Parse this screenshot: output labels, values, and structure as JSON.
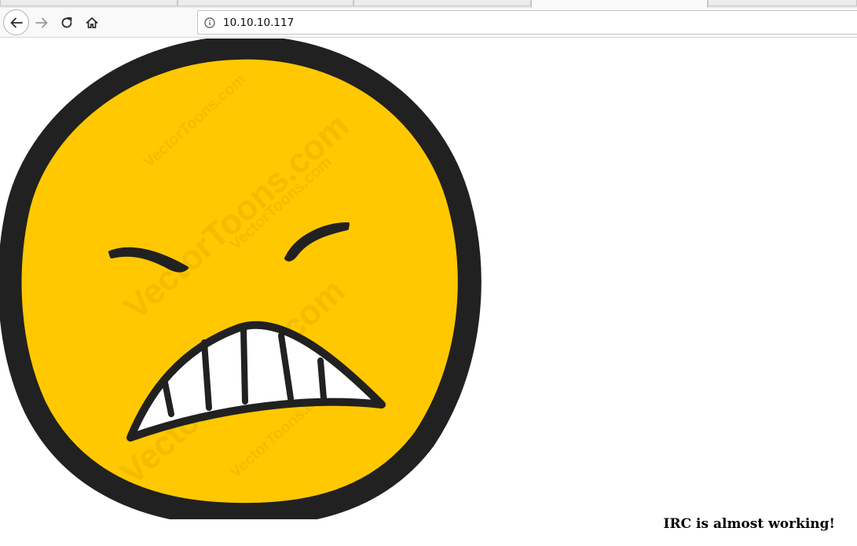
{
  "browser": {
    "url": "10.10.10.117",
    "icons": {
      "back": "arrow-left-icon",
      "forward": "arrow-right-icon",
      "reload": "reload-icon",
      "home": "home-icon",
      "site_info": "info-icon"
    }
  },
  "page": {
    "image": {
      "subject": "angry-smiley-face",
      "watermark": "VectorToons.com",
      "colors": {
        "face": "#ffc800",
        "outline": "#212121",
        "teeth": "#ffffff"
      }
    },
    "caption": "IRC is almost working!"
  }
}
